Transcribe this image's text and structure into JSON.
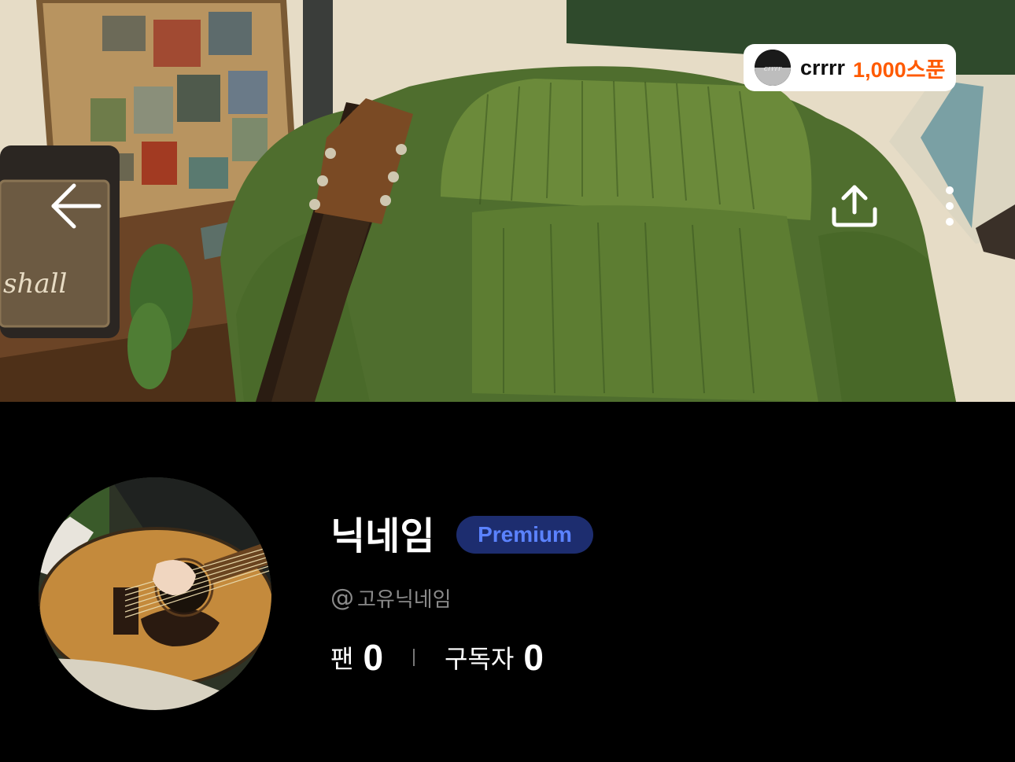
{
  "banner": {
    "back_icon": "arrow-left-icon",
    "share_icon": "share-upload-icon",
    "more_icon": "more-vertical-icon",
    "spoon_chip": {
      "avatar_icon": "user-avatar",
      "name": "crrrr",
      "amount": "1,000스푼",
      "amount_color": "#ff5a00"
    }
  },
  "profile": {
    "nickname": "닉네임",
    "badge": "Premium",
    "badge_color": "#5b82ff",
    "badge_bg": "#1d2d6f",
    "handle_prefix": "@",
    "handle": "고유닉네임",
    "fans_label": "팬",
    "fans_count": "0",
    "subscribers_label": "구독자",
    "subscribers_count": "0"
  }
}
